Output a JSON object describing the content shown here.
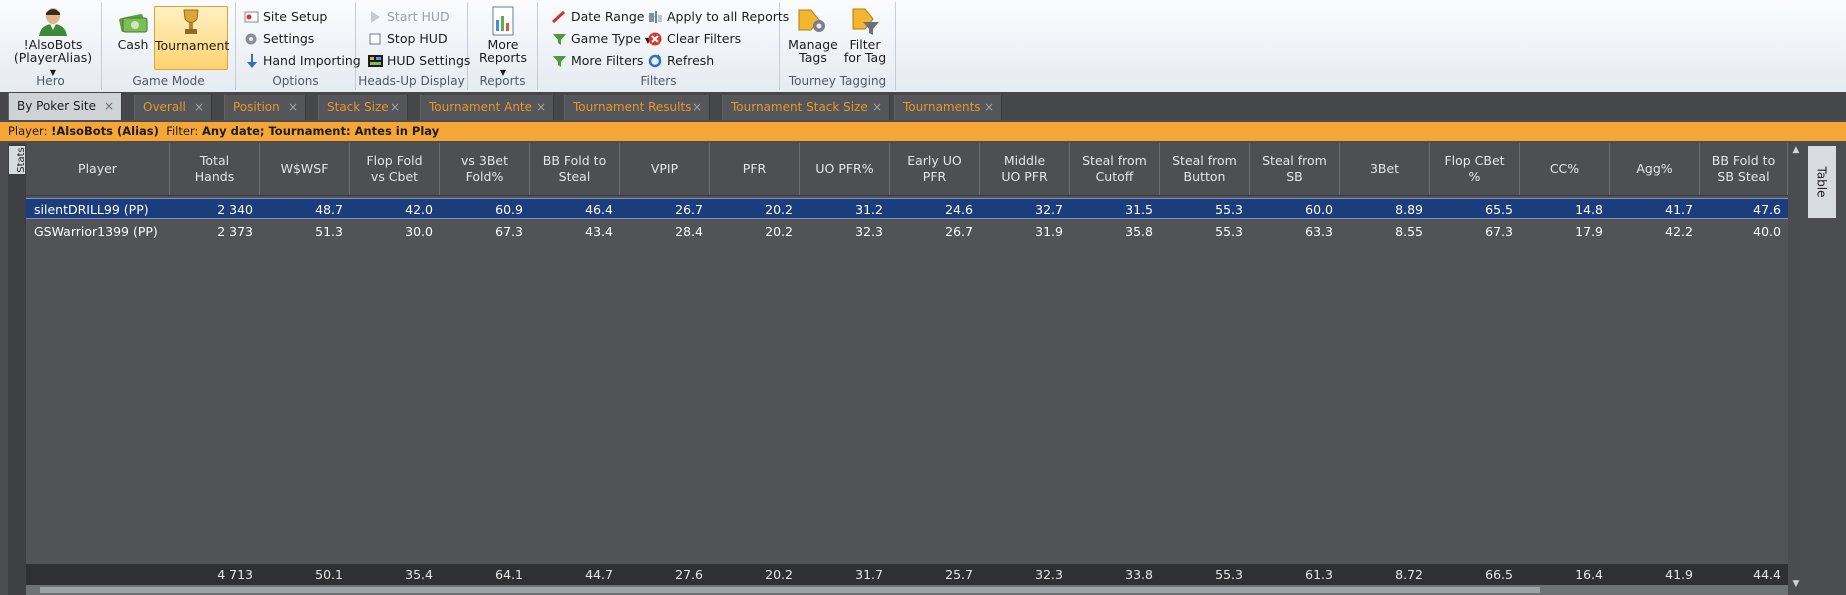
{
  "ribbon": {
    "hero": {
      "label_line1": "!AlsoBots",
      "label_line2": "(PlayerAlias)",
      "group": "Hero"
    },
    "game_mode": {
      "cash": "Cash",
      "tournament": "Tournament",
      "group": "Game Mode"
    },
    "options": {
      "site_setup": "Site Setup",
      "settings": "Settings",
      "hand_importing": "Hand Importing",
      "group": "Options"
    },
    "hud": {
      "start": "Start HUD",
      "stop": "Stop HUD",
      "settings": "HUD Settings",
      "group": "Heads-Up Display"
    },
    "reports": {
      "more_line1": "More",
      "more_line2": "Reports",
      "group": "Reports"
    },
    "filters": {
      "date_range": "Date Range",
      "game_type": "Game Type",
      "more_filters": "More Filters",
      "apply_all": "Apply to all Reports",
      "clear": "Clear Filters",
      "refresh": "Refresh",
      "group": "Filters"
    },
    "tagging": {
      "manage_line1": "Manage",
      "manage_line2": "Tags",
      "filter_line1": "Filter",
      "filter_line2": "for Tag",
      "group": "Tourney Tagging"
    }
  },
  "tabs": [
    {
      "label": "By Poker Site",
      "active": true
    },
    {
      "label": "Overall"
    },
    {
      "label": "Position"
    },
    {
      "label": "Stack Size"
    },
    {
      "label": "Tournament Ante"
    },
    {
      "label": "Tournament Results"
    },
    {
      "label": "Tournament Stack Size"
    },
    {
      "label": "Tournaments"
    }
  ],
  "filterbar": {
    "player_label": "Player: ",
    "player_value": "!AlsoBots (Alias)",
    "filter_label": "Filter: ",
    "filter_value": "Any date; Tournament: Antes in Play"
  },
  "side_tabs": {
    "left": "Stats",
    "right": "Table"
  },
  "grid": {
    "columns": [
      "Player",
      "Total\nHands",
      "W$WSF",
      "Flop Fold\nvs Cbet",
      "vs 3Bet\nFold%",
      "BB Fold to\nSteal",
      "VPIP",
      "PFR",
      "UO PFR%",
      "Early UO\nPFR",
      "Middle\nUO PFR",
      "Steal from\nCutoff",
      "Steal from\nButton",
      "Steal from\nSB",
      "3Bet",
      "Flop CBet\n%",
      "CC%",
      "Agg%",
      "BB Fold to\nSB Steal"
    ],
    "rows": [
      [
        "silentDRILL99 (PP)",
        "2 340",
        "48.7",
        "42.0",
        "60.9",
        "46.4",
        "26.7",
        "20.2",
        "31.2",
        "24.6",
        "32.7",
        "31.5",
        "55.3",
        "60.0",
        "8.89",
        "65.5",
        "14.8",
        "41.7",
        "47.6"
      ],
      [
        "GSWarrior1399 (PP)",
        "2 373",
        "51.3",
        "30.0",
        "67.3",
        "43.4",
        "28.4",
        "20.2",
        "32.3",
        "26.7",
        "31.9",
        "35.8",
        "55.3",
        "63.3",
        "8.55",
        "67.3",
        "17.9",
        "42.2",
        "40.0"
      ]
    ],
    "selected_row": 0,
    "totals": [
      "",
      "4 713",
      "50.1",
      "35.4",
      "64.1",
      "44.7",
      "27.6",
      "20.2",
      "31.7",
      "25.7",
      "32.3",
      "33.8",
      "55.3",
      "61.3",
      "8.72",
      "66.5",
      "16.4",
      "41.9",
      "44.4"
    ]
  }
}
